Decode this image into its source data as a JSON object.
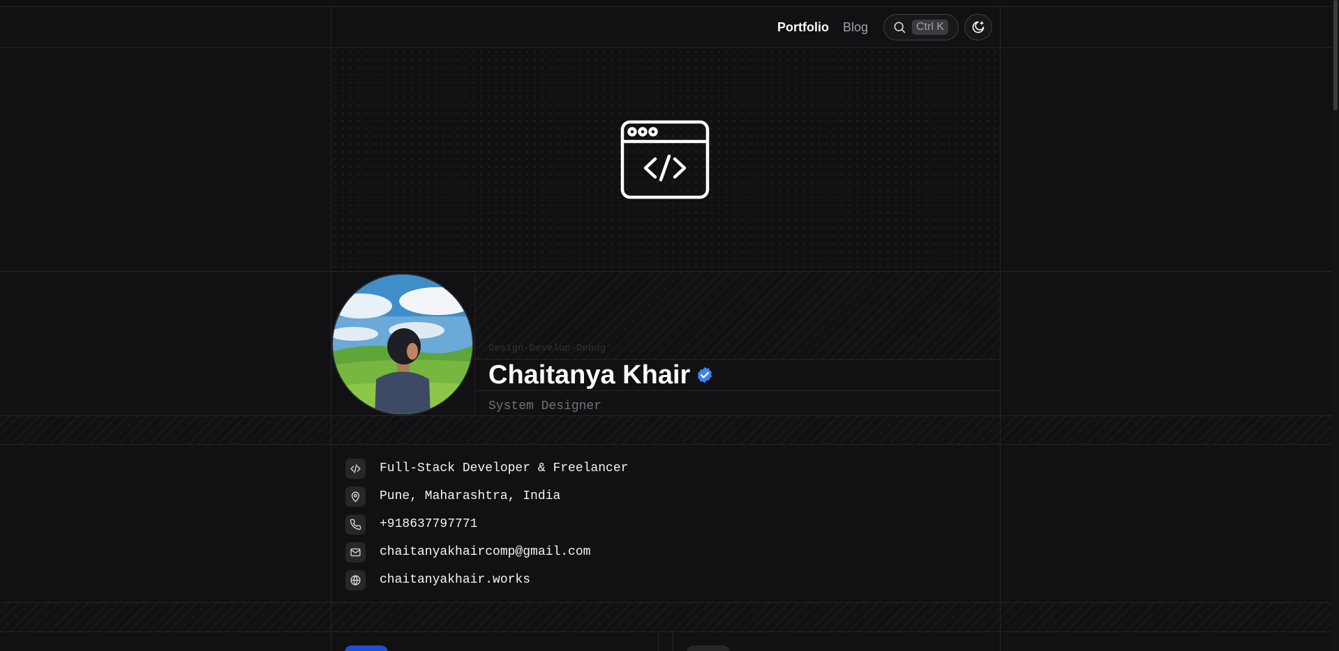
{
  "nav": {
    "portfolio": "Portfolio",
    "blog": "Blog",
    "search_shortcut": "Ctrl K"
  },
  "profile": {
    "tagline": "Design-Develop-Debug",
    "name": "Chaitanya Khair",
    "role": "System Designer",
    "verified": true
  },
  "info": [
    {
      "icon": "code-icon",
      "text": "Full-Stack Developer & Freelancer"
    },
    {
      "icon": "map-pin-icon",
      "text": "Pune, Maharashtra, India"
    },
    {
      "icon": "phone-icon",
      "text": "+918637797771"
    },
    {
      "icon": "mail-icon",
      "text": "chaitanyakhaircomp@gmail.com"
    },
    {
      "icon": "globe-icon",
      "text": "chaitanyakhair.works"
    }
  ],
  "colors": {
    "background": "#111113",
    "border": "#27272a",
    "verified_badge": "#3b82f6",
    "accent_blue": "#1d4ed8"
  }
}
